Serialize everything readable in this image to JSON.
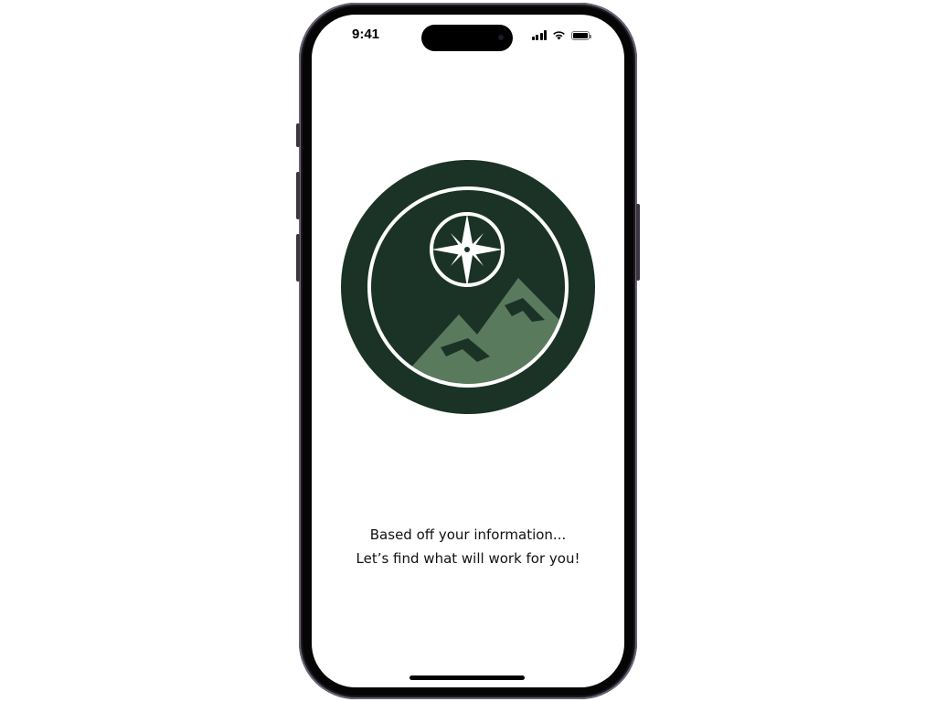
{
  "status_bar": {
    "time": "9:41",
    "signal_icon": "cellular-signal-icon",
    "wifi_icon": "wifi-icon",
    "battery_icon": "battery-icon"
  },
  "logo": {
    "icon": "compass-mountain-logo",
    "colors": {
      "background": "#1b3327",
      "ring": "#ffffff",
      "mountains": "#5a7a5e"
    }
  },
  "message": {
    "line1": "Based off your information...",
    "line2": "Let’s find what will work for you!"
  },
  "device": {
    "frame_color": "#2b2631"
  }
}
